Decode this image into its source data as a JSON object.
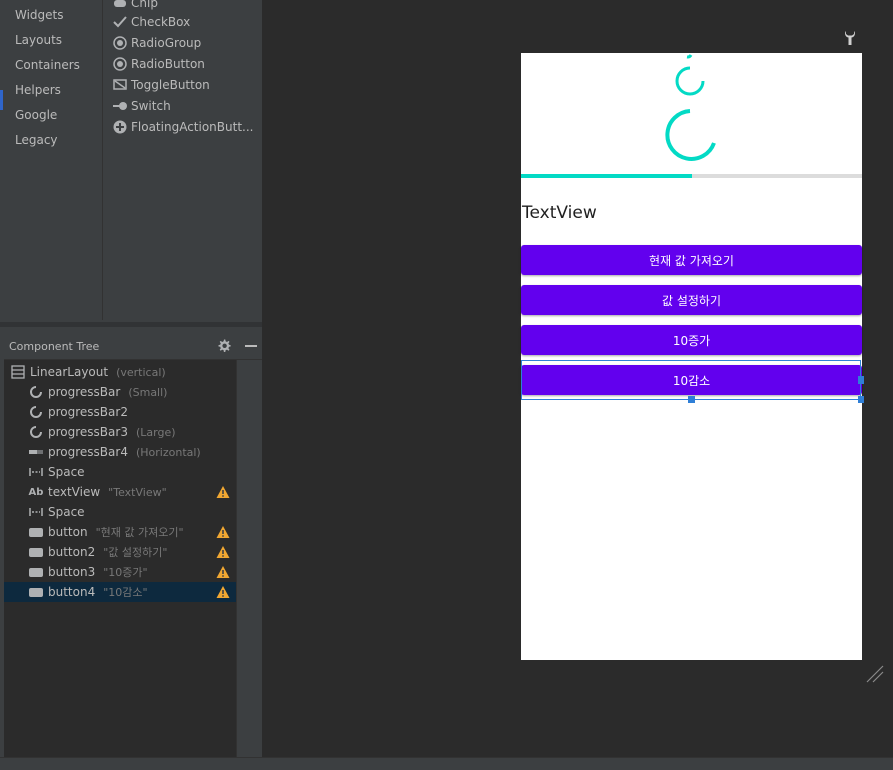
{
  "palette": {
    "categories": [
      {
        "label": "Widgets"
      },
      {
        "label": "Layouts"
      },
      {
        "label": "Containers"
      },
      {
        "label": "Helpers"
      },
      {
        "label": "Google"
      },
      {
        "label": "Legacy"
      }
    ],
    "items": [
      {
        "label": "Chip",
        "icon": "chip-icon"
      },
      {
        "label": "CheckBox",
        "icon": "checkmark-icon"
      },
      {
        "label": "RadioGroup",
        "icon": "radio-icon"
      },
      {
        "label": "RadioButton",
        "icon": "radio-icon"
      },
      {
        "label": "ToggleButton",
        "icon": "toggle-button-icon"
      },
      {
        "label": "Switch",
        "icon": "switch-icon"
      },
      {
        "label": "FloatingActionButt...",
        "icon": "fab-icon"
      }
    ]
  },
  "tree": {
    "title": "Component Tree",
    "rows": [
      {
        "name": "LinearLayout",
        "meta": "(vertical)",
        "icon": "linear-layout-icon",
        "warn": false
      },
      {
        "name": "progressBar",
        "meta": "(Small)",
        "icon": "progress-circle-icon",
        "warn": false
      },
      {
        "name": "progressBar2",
        "meta": "",
        "icon": "progress-circle-icon",
        "warn": false
      },
      {
        "name": "progressBar3",
        "meta": "(Large)",
        "icon": "progress-circle-icon",
        "warn": false
      },
      {
        "name": "progressBar4",
        "meta": "(Horizontal)",
        "icon": "progress-horizontal-icon",
        "warn": false
      },
      {
        "name": "Space",
        "meta": "",
        "icon": "space-icon",
        "warn": false
      },
      {
        "name": "textView",
        "meta": "\"TextView\"",
        "icon": "textview-icon",
        "icon_text": "Ab",
        "warn": true
      },
      {
        "name": "Space",
        "meta": "",
        "icon": "space-icon",
        "warn": false
      },
      {
        "name": "button",
        "meta": "\"현재 값 가져오기\"",
        "icon": "button-icon",
        "warn": true
      },
      {
        "name": "button2",
        "meta": "\"값 설정하기\"",
        "icon": "button-icon",
        "warn": true
      },
      {
        "name": "button3",
        "meta": "\"10증가\"",
        "icon": "button-icon",
        "warn": true
      },
      {
        "name": "button4",
        "meta": "\"10감소\"",
        "icon": "button-icon",
        "warn": true,
        "selected": true
      }
    ]
  },
  "preview": {
    "textview": "TextView",
    "buttons": [
      {
        "label": "현재 값 가져오기"
      },
      {
        "label": "값 설정하기"
      },
      {
        "label": "10증가"
      },
      {
        "label": "10감소"
      }
    ],
    "horizontal_progress": 0.5,
    "colors": {
      "accent": "#03dac5",
      "button": "#6200ee",
      "selection": "#2f7fd7"
    }
  }
}
